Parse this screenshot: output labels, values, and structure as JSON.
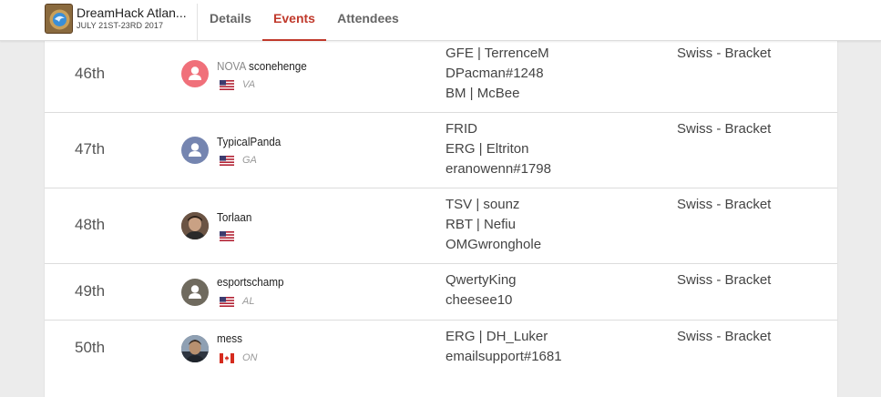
{
  "header": {
    "event_name": "DreamHack Atlan...",
    "event_dates": "JULY 21ST-23RD 2017",
    "tabs": [
      {
        "label": "Details",
        "active": false
      },
      {
        "label": "Events",
        "active": true
      },
      {
        "label": "Attendees",
        "active": false
      }
    ],
    "accent_color": "#c0392b"
  },
  "standings": [
    {
      "rank": "46th",
      "team_tag": "NOVA",
      "name": "sconehenge",
      "avatar": "default-person-icon",
      "avatar_color": "#f0707a",
      "flag": "us-flag",
      "region": "VA",
      "lines": [
        "GFE | TerrenceM",
        "DPacman#1248",
        "BM | McBee"
      ],
      "format": "Swiss - Bracket"
    },
    {
      "rank": "47th",
      "team_tag": "",
      "name": "TypicalPanda",
      "avatar": "default-person-icon",
      "avatar_color": "#7585b0",
      "flag": "us-flag",
      "region": "GA",
      "lines": [
        "FRID",
        "ERG | Eltriton",
        "eranowenn#1798"
      ],
      "format": "Swiss - Bracket"
    },
    {
      "rank": "48th",
      "team_tag": "",
      "name": "Torlaan",
      "avatar": "photo-avatar",
      "avatar_color": "#5a4636",
      "flag": "us-flag",
      "region": "",
      "lines": [
        "TSV | sounz",
        "RBT | Nefiu",
        "OMGwronghole"
      ],
      "format": "Swiss - Bracket"
    },
    {
      "rank": "49th",
      "team_tag": "",
      "name": "esportschamp",
      "avatar": "default-person-icon",
      "avatar_color": "#6f6a5e",
      "flag": "us-flag",
      "region": "AL",
      "lines": [
        "QwertyKing",
        "cheesee10"
      ],
      "format": "Swiss - Bracket"
    },
    {
      "rank": "50th",
      "team_tag": "",
      "name": "mess",
      "avatar": "photo-avatar",
      "avatar_color": "#4d5a6b",
      "flag": "ca-flag",
      "region": "ON",
      "lines": [
        "ERG | DH_Luker",
        "emailsupport#1681"
      ],
      "format": "Swiss - Bracket"
    }
  ]
}
